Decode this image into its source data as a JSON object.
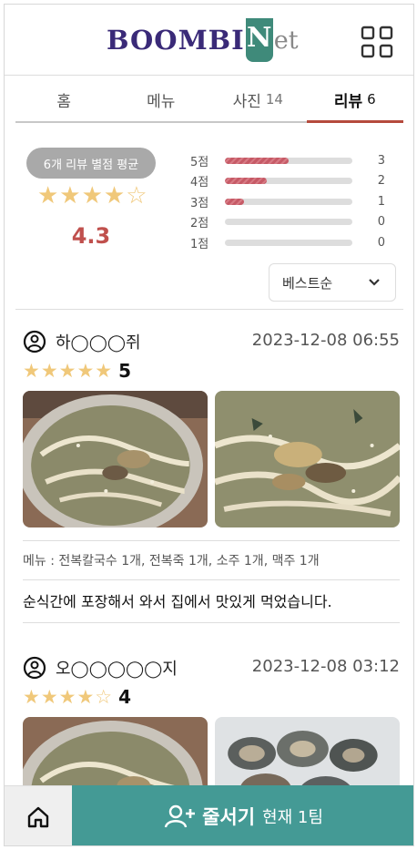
{
  "header": {
    "logo_main": "BOOMBI",
    "logo_n": "N",
    "logo_tail": "et",
    "menu_icon": "grid-icon"
  },
  "tabs": [
    {
      "label": "홈",
      "count": ""
    },
    {
      "label": "메뉴",
      "count": ""
    },
    {
      "label": "사진",
      "count": "14"
    },
    {
      "label": "리뷰",
      "count": "6",
      "active": true
    }
  ],
  "summary": {
    "badge": "6개 리뷰 별점 평균",
    "stars": "★★★★☆",
    "average": "4.3",
    "rating_fraction": 0.86,
    "distribution": [
      {
        "label": "5점",
        "count": "3",
        "fraction": 0.5
      },
      {
        "label": "4점",
        "count": "2",
        "fraction": 0.33
      },
      {
        "label": "3점",
        "count": "1",
        "fraction": 0.15
      },
      {
        "label": "2점",
        "count": "0",
        "fraction": 0
      },
      {
        "label": "1점",
        "count": "0",
        "fraction": 0
      }
    ]
  },
  "sort": {
    "label": "베스트순",
    "icon": "chevron-down-icon"
  },
  "reviews": [
    {
      "user": "하◯◯◯쥐",
      "date": "2023-12-08 06:55",
      "stars": "★★★★★",
      "score": "5",
      "menu": "메뉴 : 전복칼국수 1개, 전복죽 1개, 소주 1개, 맥주 1개",
      "text": "순식간에 포장해서 와서 집에서 맛있게 먹었습니다."
    },
    {
      "user": "오◯◯◯◯◯지",
      "date": "2023-12-08 03:12",
      "stars": "★★★★☆",
      "score": "4"
    }
  ],
  "bottom": {
    "home_icon": "home-icon",
    "queue_icon": "add-user-icon",
    "queue_label": "줄서기",
    "queue_status": "현재 1팀"
  },
  "colors": {
    "accent_red": "#b54a3d",
    "star": "#f0c87a",
    "teal": "#449a95",
    "rating_red": "#c0504d"
  }
}
